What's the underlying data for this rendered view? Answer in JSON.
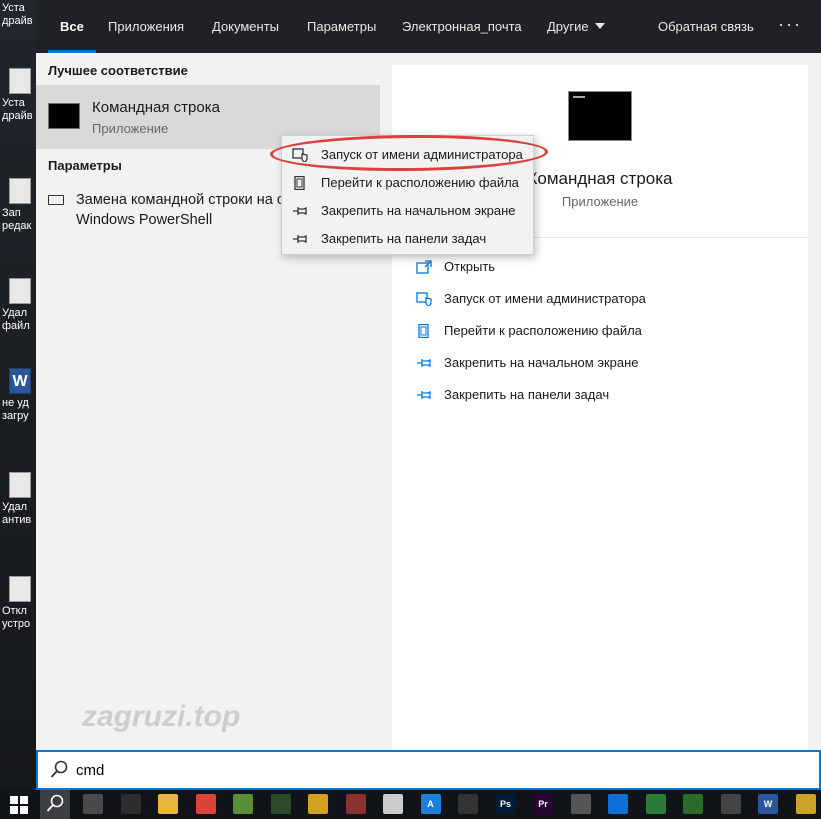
{
  "desktop": {
    "icons": [
      {
        "label": "Уста\nдрайв"
      },
      {
        "label": "Уста\nдрайв"
      },
      {
        "label": "Зап\nредак"
      },
      {
        "label": "Удал\nфайл"
      },
      {
        "label": "не уд\nзагру"
      },
      {
        "label": "Удал\nантив"
      },
      {
        "label": "Откл\nустро"
      }
    ]
  },
  "tabs": [
    {
      "label": "Все",
      "active": true
    },
    {
      "label": "Приложения"
    },
    {
      "label": "Документы"
    },
    {
      "label": "Параметры"
    },
    {
      "label": "Электронная_почта"
    },
    {
      "label": "Другие"
    }
  ],
  "feedback_label": "Обратная связь",
  "more_label": "···",
  "left": {
    "best_match_heading": "Лучшее соответствие",
    "best_match": {
      "title": "Командная строка",
      "subtitle": "Приложение"
    },
    "settings_heading": "Параметры",
    "settings_item": "Замена командной строки на оболочку Windows PowerShell"
  },
  "context_menu": [
    {
      "label": "Запуск от имени администратора",
      "icon": "shield-icon"
    },
    {
      "label": "Перейти к расположению файла",
      "icon": "file-icon"
    },
    {
      "label": "Закрепить на начальном экране",
      "icon": "pin-icon"
    },
    {
      "label": "Закрепить на панели задач",
      "icon": "pin-icon"
    }
  ],
  "right": {
    "title": "Командная строка",
    "subtitle": "Приложение",
    "actions": [
      {
        "label": "Открыть",
        "icon": "open-icon"
      },
      {
        "label": "Запуск от имени администратора",
        "icon": "shield-icon"
      },
      {
        "label": "Перейти к расположению файла",
        "icon": "file-icon"
      },
      {
        "label": "Закрепить на начальном экране",
        "icon": "pin-icon"
      },
      {
        "label": "Закрепить на панели задач",
        "icon": "pin-icon"
      }
    ]
  },
  "watermark": "zagruzi.top",
  "search": {
    "value": "cmd"
  },
  "taskbar": {
    "apps": [
      {
        "name": "calculator-icon",
        "color": "#4a4a4a",
        "text": ""
      },
      {
        "name": "mail-icon",
        "color": "#2d2d2d",
        "text": ""
      },
      {
        "name": "folder-icon",
        "color": "#e8b53a",
        "text": ""
      },
      {
        "name": "chrome-icon",
        "color": "#db4437",
        "text": ""
      },
      {
        "name": "game-icon",
        "color": "#5a8f3a",
        "text": ""
      },
      {
        "name": "star-icon",
        "color": "#2a4a2a",
        "text": ""
      },
      {
        "name": "app-icon",
        "color": "#d4a020",
        "text": ""
      },
      {
        "name": "tool-icon",
        "color": "#8a3030",
        "text": ""
      },
      {
        "name": "document-icon",
        "color": "#cccccc",
        "text": ""
      },
      {
        "name": "app-a-icon",
        "color": "#1e7fd8",
        "text": "A"
      },
      {
        "name": "steam-icon",
        "color": "#333333",
        "text": ""
      },
      {
        "name": "photoshop-icon",
        "color": "#001d34",
        "text": "Ps"
      },
      {
        "name": "premiere-icon",
        "color": "#2a0033",
        "text": "Pr"
      },
      {
        "name": "tool2-icon",
        "color": "#555555",
        "text": ""
      },
      {
        "name": "teamviewer-icon",
        "color": "#0e6fd8",
        "text": ""
      },
      {
        "name": "app2-icon",
        "color": "#2a7a3a",
        "text": ""
      },
      {
        "name": "app3-icon",
        "color": "#2a6a2a",
        "text": ""
      },
      {
        "name": "app4-icon",
        "color": "#444444",
        "text": ""
      },
      {
        "name": "word-icon",
        "color": "#2b579a",
        "text": "W"
      },
      {
        "name": "app5-icon",
        "color": "#c9a227",
        "text": ""
      }
    ]
  }
}
